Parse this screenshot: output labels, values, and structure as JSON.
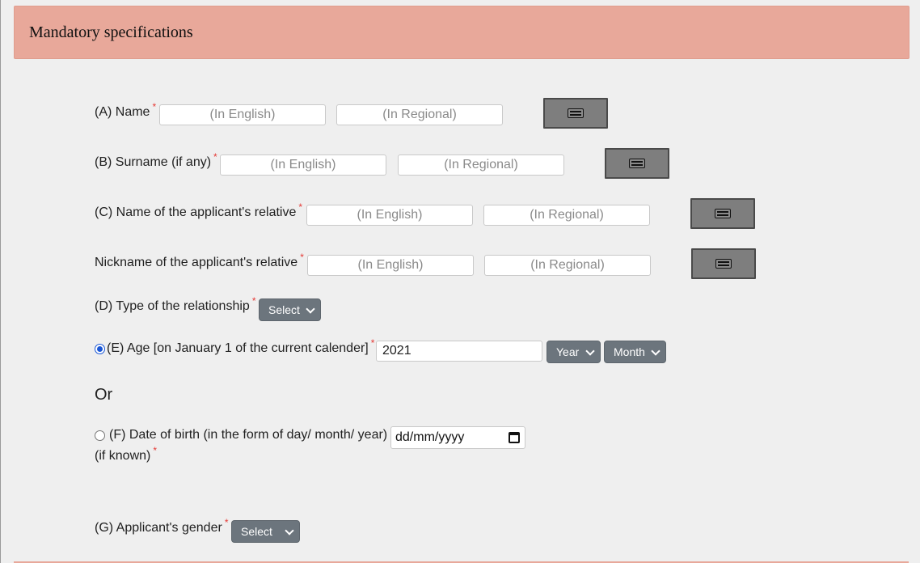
{
  "header": {
    "title": "Mandatory specifications"
  },
  "required_mark": "*",
  "keyboard_icon": "keyboard-icon",
  "fields": {
    "name": {
      "label": "(A) Name",
      "english_placeholder": "(In English)",
      "regional_placeholder": "(In Regional)"
    },
    "surname": {
      "label": "(B) Surname (if any)",
      "english_placeholder": "(In English)",
      "regional_placeholder": "(In Regional)"
    },
    "relative_name": {
      "label": "(C) Name of the applicant's relative",
      "english_placeholder": "(In English)",
      "regional_placeholder": "(In Regional)"
    },
    "relative_nickname": {
      "label": "Nickname of the applicant's relative",
      "english_placeholder": "(In English)",
      "regional_placeholder": "(In Regional)"
    },
    "relationship_type": {
      "label": "(D) Type of the relationship",
      "selected": "Select"
    },
    "age": {
      "label": "(E) Age [on January 1 of the current calender]",
      "value": "2021",
      "year_select": "Year",
      "month_select": "Month",
      "selected": true
    },
    "or_text": "Or",
    "dob": {
      "label": "(F) Date of birth (in the form of day/ month/ year)",
      "sublabel": "(if known)",
      "placeholder": "dd/mm/yyyy",
      "selected": false
    },
    "gender": {
      "label": "(G) Applicant's gender",
      "selected": "Select"
    }
  },
  "colors": {
    "header_bg": "#e8a89a",
    "select_bg": "#6c757d",
    "keyboard_button_bg": "#7e7e7e",
    "required": "#e53935",
    "radio_accent": "#1a57d6"
  }
}
